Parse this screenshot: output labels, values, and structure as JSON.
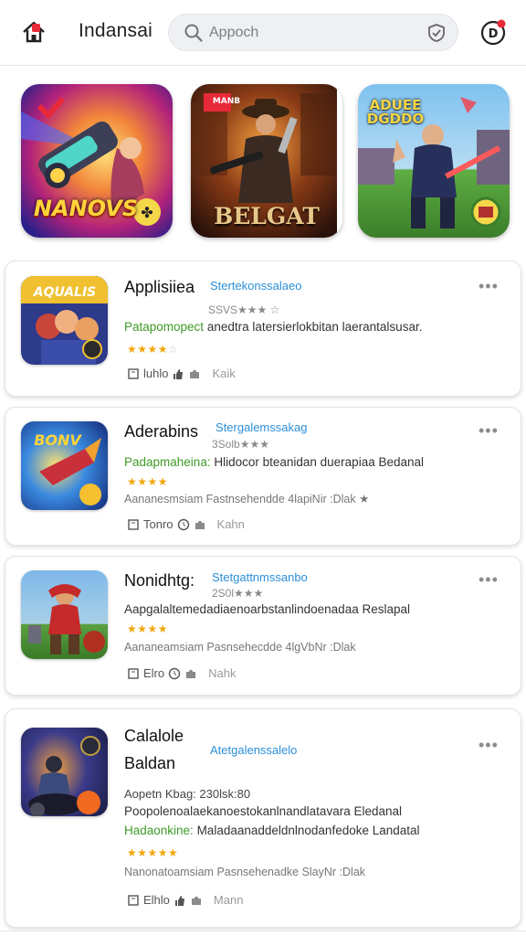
{
  "header": {
    "title": "Indansai",
    "search_placeholder": "Appoch"
  },
  "featured": [
    {
      "label": "NANOVS"
    },
    {
      "label": "BELGAT",
      "top_text": "MANB"
    },
    {
      "label": "ADUEE DGDDO"
    }
  ],
  "cards": [
    {
      "title_lines": [
        "Applisiiea"
      ],
      "publisher": "Stertekonssalaeo",
      "meta": "SSVS★★★ ☆",
      "desc_green": "Patapomopect",
      "desc_rest": " anedtra latersierlokbitan laerantalsusar.",
      "desc2": "",
      "stars": "★★★★",
      "stars_empty": "☆",
      "footer_label": "luhlo",
      "footer_author": "Kaik"
    },
    {
      "title_lines": [
        "Aderabins"
      ],
      "publisher": "Stergalemssakag",
      "meta": "3Solb★★★",
      "desc_green": "Padapmaheina:",
      "desc_rest": " Hlidocor bteanidan duerapiaa Bedanal",
      "desc2": "Aananesmsiam Fastnsehendde 4lapiNir :Dlak ★",
      "stars": "★★★★",
      "stars_empty": "",
      "footer_label": "Tonro",
      "footer_author": "Kahn"
    },
    {
      "title_lines": [
        "Nonidhtg:"
      ],
      "publisher": "Stetgattnmssanbo",
      "meta": "2S0l★★★",
      "desc_green": "",
      "desc_rest": "Aapgalaltemedadiaenoarbstanlindoenadaa Reslapal",
      "desc2": "Aananeamsiam Pasnsehecdde 4lgVbNr :Dlak",
      "stars": "★★★★",
      "stars_empty": "",
      "footer_label": "Elro",
      "footer_author": "Nahk"
    },
    {
      "title_lines": [
        "Calalole",
        "Baldan"
      ],
      "publisher": "Atetgalenssalelo",
      "meta": "Aopetn Kbag:  230lsk:80",
      "desc_green": "",
      "desc_rest": "Poopolenoalaekanoestokanlnandlatavara Eledanal",
      "desc_green2": "Hadaonkine:",
      "desc_rest2": " Maladaanaddeldnlnodanfedoke Landatal",
      "desc2": "Nanonatoamsiam Pasnsehenadke SlayNr :Dlak",
      "stars": "★★★★★",
      "stars_empty": "",
      "footer_label": "Elhlo",
      "footer_author": "Mann"
    }
  ]
}
